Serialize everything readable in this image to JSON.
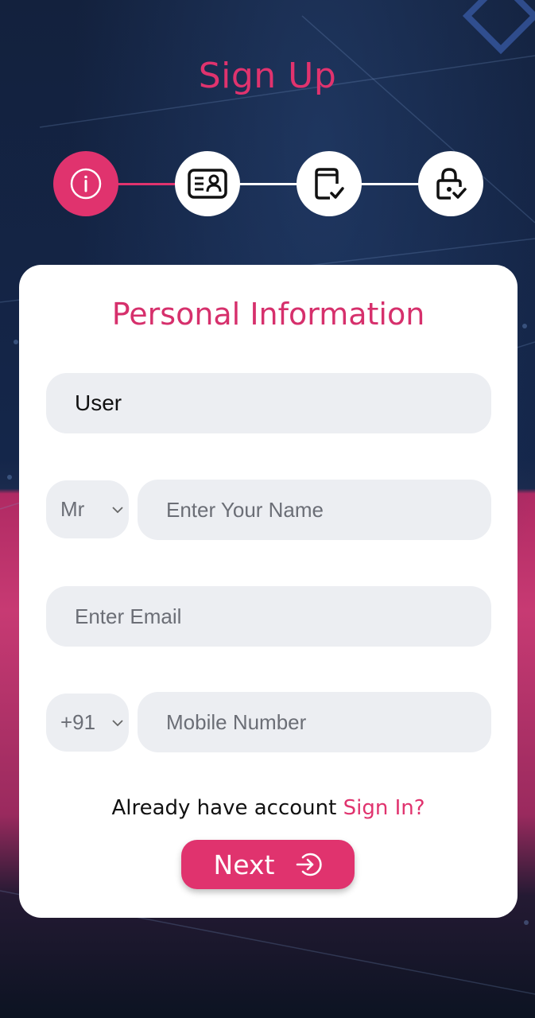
{
  "header": {
    "title": "Sign Up"
  },
  "stepper": {
    "steps": [
      {
        "icon": "info-icon",
        "active": true
      },
      {
        "icon": "id-card-icon",
        "active": false
      },
      {
        "icon": "phone-verified-icon",
        "active": false
      },
      {
        "icon": "lock-check-icon",
        "active": false
      }
    ]
  },
  "form": {
    "title": "Personal Information",
    "user_type_value": "User",
    "salutation": {
      "selected": "Mr"
    },
    "name_placeholder": "Enter Your Name",
    "email_placeholder": "Enter Email",
    "country_code": {
      "selected": "+91"
    },
    "mobile_placeholder": "Mobile Number",
    "signin_prompt": "Already have account",
    "signin_link": "Sign In?",
    "next_label": "Next"
  },
  "colors": {
    "accent": "#e0336e",
    "field_bg": "#eceef2",
    "card_bg": "#ffffff"
  }
}
